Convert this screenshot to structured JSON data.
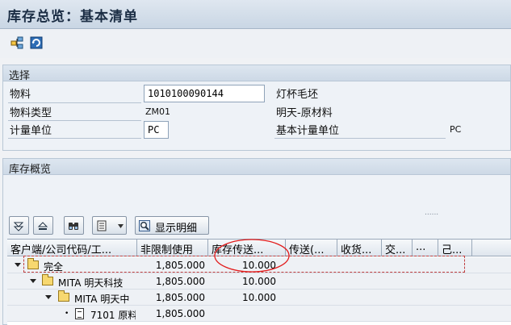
{
  "title": "库存总览：基本清单",
  "toolbar": {
    "icons": [
      "hierarchy-icon",
      "refresh-icon"
    ]
  },
  "selection": {
    "heading": "选择",
    "material_label": "物料",
    "material_value": "1010100090144",
    "material_desc": "灯杯毛坯",
    "material_type_label": "物料类型",
    "material_type_value": "ZM01",
    "material_type_desc": "明天-原材料",
    "unit_label": "计量单位",
    "unit_value": "PC",
    "base_unit_label": "基本计量单位",
    "base_unit_value": "PC"
  },
  "overview": {
    "heading": "库存概览",
    "dots": "......",
    "show_detail_label": "显示明细"
  },
  "grid": {
    "columns": [
      "客户端/公司代码/工...",
      "非限制使用",
      "库存传送...",
      "传送(...",
      "收货...",
      "交...",
      "...",
      "己..."
    ],
    "rows": [
      {
        "name": "完全",
        "unrestricted": "1,805.000",
        "transfer": "10.000"
      },
      {
        "name": "MITA 明天科技",
        "unrestricted": "1,805.000",
        "transfer": "10.000"
      },
      {
        "name": "MITA 明天中",
        "unrestricted": "1,805.000",
        "transfer": "10.000"
      },
      {
        "name": "7101 原料",
        "unrestricted": "1,805.000",
        "transfer": ""
      }
    ]
  },
  "colors": {
    "annotation": "#e21b1b",
    "titlebar": "#c9d6e4"
  }
}
